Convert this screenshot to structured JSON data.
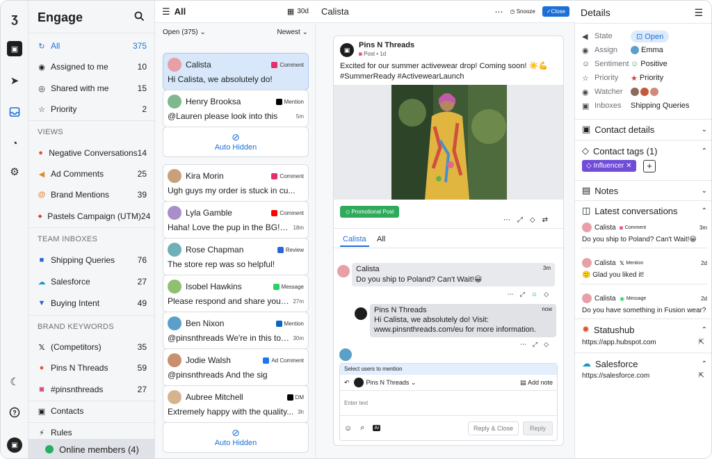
{
  "sidebar": {
    "title": "Engage",
    "items": [
      {
        "icon": "mention-icon",
        "label": "All",
        "count": "375"
      },
      {
        "icon": "person-icon",
        "label": "Assigned to me",
        "count": "10"
      },
      {
        "icon": "shared-icon",
        "label": "Shared with me",
        "count": "15"
      },
      {
        "icon": "star-icon",
        "label": "Priority",
        "count": "2"
      }
    ],
    "views_label": "VIEWS",
    "views": [
      {
        "label": "Negative Conversations",
        "count": "14"
      },
      {
        "label": "Ad Comments",
        "count": "25"
      },
      {
        "label": "Brand Mentions",
        "count": "39"
      },
      {
        "label": "Pastels Campaign (UTM)",
        "count": "24"
      }
    ],
    "team_label": "TEAM INBOXES",
    "team": [
      {
        "label": "Shipping Queries",
        "count": "76"
      },
      {
        "label": "Salesforce",
        "count": "27"
      },
      {
        "label": "Buying Intent",
        "count": "49"
      }
    ],
    "brand_label": "BRAND KEYWORDS",
    "brand": [
      {
        "label": "(Competitors)",
        "count": "35"
      },
      {
        "label": "Pins N Threads",
        "count": "59"
      },
      {
        "label": "#pinsnthreads",
        "count": "27"
      }
    ],
    "contacts": "Contacts",
    "rules": "Rules",
    "online": "Online members (4)"
  },
  "list": {
    "title": "All",
    "range": "30d",
    "filter": "Open (375)",
    "sort": "Newest",
    "cards": [
      {
        "name": "Calista",
        "source": "Comment",
        "msg": "Hi Calista, we absolutely do!",
        "time": "",
        "av": "#e8a0a8",
        "badge": "#e1306c"
      },
      {
        "name": "Henry Brooksa",
        "source": "Mention",
        "msg": "@Lauren please look into this",
        "time": "5m",
        "av": "#7fb88f",
        "badge": "#000"
      },
      {
        "name": "Kira Morin",
        "source": "Comment",
        "msg": "Ugh guys my order is stuck in cu...",
        "time": "",
        "av": "#c9a07a",
        "badge": "#e1306c"
      },
      {
        "name": "Lyla Gamble",
        "source": "Comment",
        "msg": "Haha! Love the pup in the BG! 🐶",
        "time": "18m",
        "av": "#a98fc9",
        "badge": "#ff0000"
      },
      {
        "name": "Rose Chapman",
        "source": "Review",
        "msg": "The store rep was so helpful!",
        "time": "",
        "av": "#6fb0b8",
        "badge": "#2c65d9"
      },
      {
        "name": "Isobel Hawkins",
        "source": "Message",
        "msg": "Please respond and share your in...",
        "time": "27m",
        "av": "#8fbf6f",
        "badge": "#25d366"
      },
      {
        "name": "Ben Nixon",
        "source": "Mention",
        "msg": "@pinsnthreads We're in this toge...",
        "time": "30m",
        "av": "#5aa0c8",
        "badge": "#0a66c2"
      },
      {
        "name": "Jodie Walsh",
        "source": "Ad Comment",
        "msg": "@pinsnthreads And the sig",
        "time": "",
        "av": "#c98f6f",
        "badge": "#1877f2"
      },
      {
        "name": "Aubree Mitchell",
        "source": "DM",
        "msg": "Extremely happy with the quality...",
        "time": "3h",
        "av": "#d6b38f",
        "badge": "#000"
      }
    ],
    "hidden": "Auto Hidden"
  },
  "main": {
    "title": "Calista",
    "snooze": "Snooze",
    "close": "Close",
    "post_author": "Pins N Threads",
    "post_meta": "Post • 1d",
    "post_text": "Excited for our summer activewear drop! Coming soon! ☀️💪 #SummerReady #ActivewearLaunch",
    "tag": "Promotional Post",
    "tabs": [
      "Calista",
      "All"
    ],
    "msg1_name": "Calista",
    "msg1_time": "3m",
    "msg1_text": "Do you ship to Poland? Can't Wait!😀",
    "msg2_name": "Pins N Threads",
    "msg2_time": "now",
    "msg2_text": "Hi Calista, we absolutely do! Visit: www.pinsnthreads.com/eu for more information.",
    "mention_hint": "Select users to mention",
    "reply_as": "Pins N Threads",
    "add_note": "Add note",
    "placeholder": "Enter text",
    "reply_close": "Reply & Close",
    "reply": "Reply"
  },
  "details": {
    "title": "Details",
    "rows": [
      {
        "k": "State",
        "v": "Open"
      },
      {
        "k": "Assign",
        "v": "Emma"
      },
      {
        "k": "Sentiment",
        "v": "Positive"
      },
      {
        "k": "Priority",
        "v": "Priority"
      },
      {
        "k": "Watcher",
        "v": ""
      },
      {
        "k": "Inboxes",
        "v": "Shipping Queries"
      }
    ],
    "contact_details": "Contact details",
    "contact_tags": "Contact tags (1)",
    "tag": "Influencer",
    "notes": "Notes",
    "latest": "Latest conversations",
    "convs": [
      {
        "name": "Calista",
        "src": "Comment",
        "time": "3m",
        "text": "Do you ship to Poland? Can't Wait!😀"
      },
      {
        "name": "Calista",
        "src": "Mention",
        "time": "2d",
        "text": "🙂 Glad you liked it!"
      },
      {
        "name": "Calista",
        "src": "Message",
        "time": "2d",
        "text": "Do you have something in Fusion wear?"
      }
    ],
    "statushub": "Statushub",
    "statushub_url": "https://app.hubspot.com",
    "salesforce": "Salesforce",
    "salesforce_url": "https://salesforce.com"
  },
  "colors": {
    "accent": "#1d6fd6",
    "selected": "#d8e8fa",
    "online": "#27ae60"
  }
}
